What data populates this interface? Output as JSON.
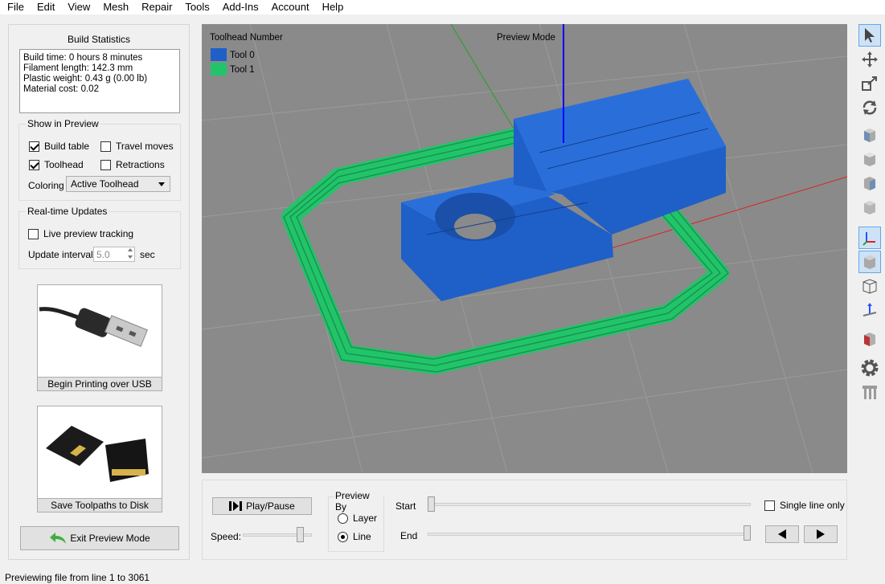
{
  "menu": [
    "File",
    "Edit",
    "View",
    "Mesh",
    "Repair",
    "Tools",
    "Add-Ins",
    "Account",
    "Help"
  ],
  "build_stats": {
    "title": "Build Statistics",
    "lines": [
      "Build time: 0 hours 8 minutes",
      "Filament length: 142.3 mm",
      "Plastic weight: 0.43 g (0.00 lb)",
      "Material cost: 0.02"
    ]
  },
  "show_in_preview": {
    "title": "Show in Preview",
    "build_table": {
      "label": "Build table",
      "checked": true
    },
    "travel_moves": {
      "label": "Travel moves",
      "checked": false
    },
    "toolhead": {
      "label": "Toolhead",
      "checked": true
    },
    "retractions": {
      "label": "Retractions",
      "checked": false
    },
    "coloring_label": "Coloring",
    "coloring_value": "Active Toolhead"
  },
  "realtime": {
    "title": "Real-time Updates",
    "live_tracking": {
      "label": "Live preview tracking",
      "checked": false
    },
    "interval_label": "Update interval",
    "interval_value": "5.0",
    "interval_unit": "sec"
  },
  "usb_button": {
    "label": "Begin Printing over USB",
    "image": "usb-cable-image"
  },
  "sd_button": {
    "label": "Save Toolpaths to Disk",
    "image": "sd-card-image"
  },
  "exit_button": {
    "label": "Exit Preview Mode",
    "icon": "back-arrow-icon"
  },
  "viewport": {
    "legend_title": "Toolhead Number",
    "mode_label": "Preview Mode",
    "tools": [
      {
        "name": "Tool 0",
        "color": "#1f5fc8"
      },
      {
        "name": "Tool 1",
        "color": "#22c46a"
      }
    ],
    "background": "#8a8a8a"
  },
  "controls": {
    "play_label": "Play/Pause",
    "speed_label": "Speed:",
    "preview_by_title": "Preview By",
    "layer_label": "Layer",
    "line_label": "Line",
    "preview_by_selected": "Line",
    "start_label": "Start",
    "end_label": "End",
    "single_line_label": "Single line only",
    "single_line_checked": false
  },
  "right_toolbar": [
    "select-arrow-icon",
    "move-icon",
    "scale-icon",
    "rotate-icon",
    "view-front-icon",
    "view-top-icon",
    "view-side-icon",
    "view-back-icon",
    "axes-icon",
    "solid-view-icon",
    "wireframe-icon",
    "normal-icon",
    "section-view-icon",
    "settings-gear-icon",
    "supports-icon"
  ],
  "status": "Previewing file from line 1 to 3061"
}
